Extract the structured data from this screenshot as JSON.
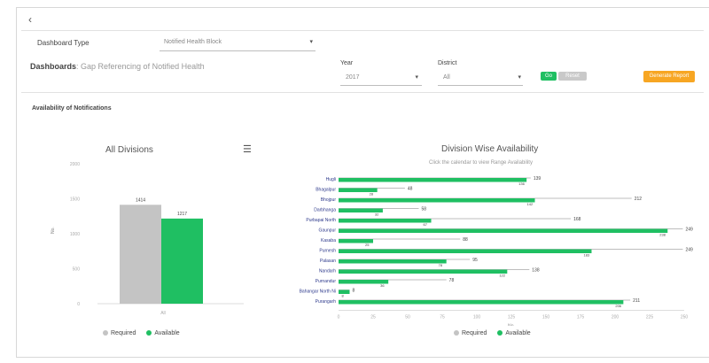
{
  "header": {
    "back_icon": "chevron-left-icon",
    "dashboard_type_label": "Dashboard Type",
    "dashboard_type_value": "Notified Health Block",
    "dashboard_title_bold": "Dashboards",
    "dashboard_title_rest": ": Gap Referencing of Notified Health",
    "year_label": "Year",
    "year_value": "2017",
    "district_label": "District",
    "district_value": "All",
    "btn_go": "Go",
    "btn_reset": "Reset",
    "btn_export": "Generate Report"
  },
  "section_title": "Availability of Notifications",
  "colors": {
    "required": "#c4c4c4",
    "available": "#1fbf62",
    "accent": "#f7a623"
  },
  "chart_data": [
    {
      "type": "bar",
      "title": "All Divisions",
      "categories": [
        "All"
      ],
      "series": [
        {
          "name": "Required",
          "values": [
            1414
          ]
        },
        {
          "name": "Available",
          "values": [
            1217
          ]
        }
      ],
      "ylim": [
        0,
        2000
      ],
      "yticks": [
        0,
        500,
        1000,
        1500,
        2000
      ],
      "ylabel": "No.",
      "legend": "bottom-center",
      "grid": false
    },
    {
      "type": "bar",
      "orientation": "horizontal",
      "title": "Division Wise Availability",
      "subtitle": "Click the calendar to view Range Availability",
      "categories": [
        "Hugli",
        "Bhagalpur",
        "Bhojpur",
        "Darbhanga",
        "Purbapai North",
        "Gaunpur",
        "Kasaba",
        "Purnesh",
        "Palasan",
        "Nandarh",
        "Purnandur",
        "Bahangar North Ni",
        "Purangarh"
      ],
      "series": [
        {
          "name": "Required",
          "values": [
            139,
            48,
            212,
            58,
            168,
            249,
            88,
            249,
            95,
            138,
            78,
            8,
            211
          ]
        },
        {
          "name": "Available",
          "values": [
            136,
            28,
            142,
            32,
            67,
            238,
            25,
            183,
            78,
            122,
            36,
            8,
            206
          ]
        }
      ],
      "xlim": [
        0,
        250
      ],
      "xticks": [
        0,
        25,
        50,
        75,
        100,
        125,
        150,
        175,
        200,
        225,
        250
      ],
      "xlabel": "No.",
      "legend": "bottom-center",
      "grid": false
    }
  ]
}
